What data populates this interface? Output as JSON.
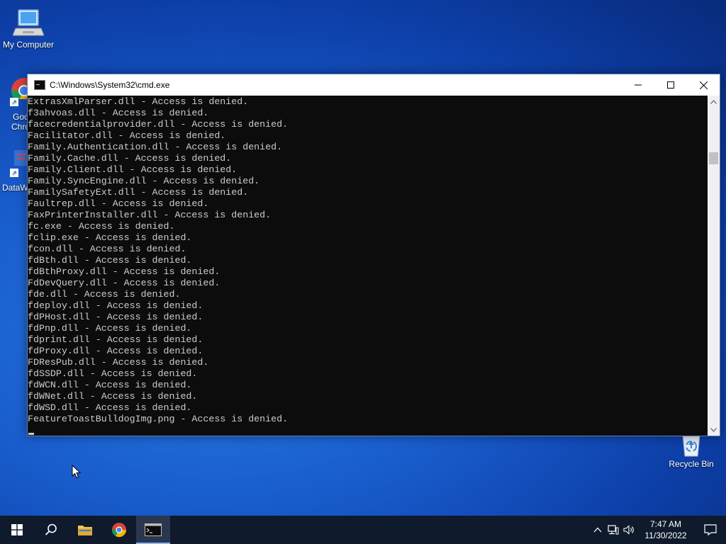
{
  "desktop": {
    "icons": [
      {
        "label": "My Computer"
      },
      {
        "label": "Recycle Bin"
      }
    ],
    "partial_icons": [
      {
        "label_lines": [
          "Goo",
          "Chro"
        ]
      },
      {
        "label_lines": [
          "DataW"
        ]
      }
    ]
  },
  "window": {
    "title": "C:\\Windows\\System32\\cmd.exe",
    "controls": {
      "minimize": "—",
      "maximize": "☐",
      "close": "✕"
    },
    "console_lines": [
      "ExtrasXmlParser.dll - Access is denied.",
      "f3ahvoas.dll - Access is denied.",
      "facecredentialprovider.dll - Access is denied.",
      "Facilitator.dll - Access is denied.",
      "Family.Authentication.dll - Access is denied.",
      "Family.Cache.dll - Access is denied.",
      "Family.Client.dll - Access is denied.",
      "Family.SyncEngine.dll - Access is denied.",
      "FamilySafetyExt.dll - Access is denied.",
      "Faultrep.dll - Access is denied.",
      "FaxPrinterInstaller.dll - Access is denied.",
      "fc.exe - Access is denied.",
      "fclip.exe - Access is denied.",
      "fcon.dll - Access is denied.",
      "fdBth.dll - Access is denied.",
      "fdBthProxy.dll - Access is denied.",
      "FdDevQuery.dll - Access is denied.",
      "fde.dll - Access is denied.",
      "fdeploy.dll - Access is denied.",
      "fdPHost.dll - Access is denied.",
      "fdPnp.dll - Access is denied.",
      "fdprint.dll - Access is denied.",
      "fdProxy.dll - Access is denied.",
      "FDResPub.dll - Access is denied.",
      "fdSSDP.dll - Access is denied.",
      "fdWCN.dll - Access is denied.",
      "fdWNet.dll - Access is denied.",
      "fdWSD.dll - Access is denied.",
      "FeatureToastBulldogImg.png - Access is denied."
    ]
  },
  "taskbar": {
    "clock": {
      "time": "7:47 AM",
      "date": "11/30/2022"
    }
  },
  "colors": {
    "console_bg": "#0c0c0c",
    "console_text": "#cccccc",
    "taskbar_bg": "#0f1a2d"
  }
}
